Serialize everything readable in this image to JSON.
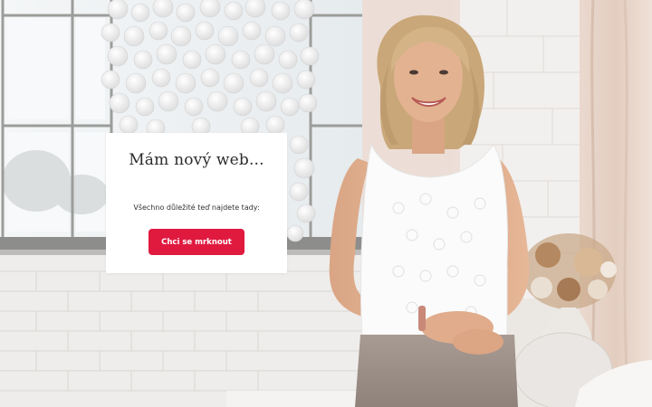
{
  "popup": {
    "title": "Mám nový web...",
    "text": "Všechno důležité teď najdete tady:",
    "button_label": "Chci se mrknout"
  },
  "colors": {
    "button": "#e0193f",
    "wall": "#e9e5e1",
    "window_frame": "#9c9d9a"
  }
}
